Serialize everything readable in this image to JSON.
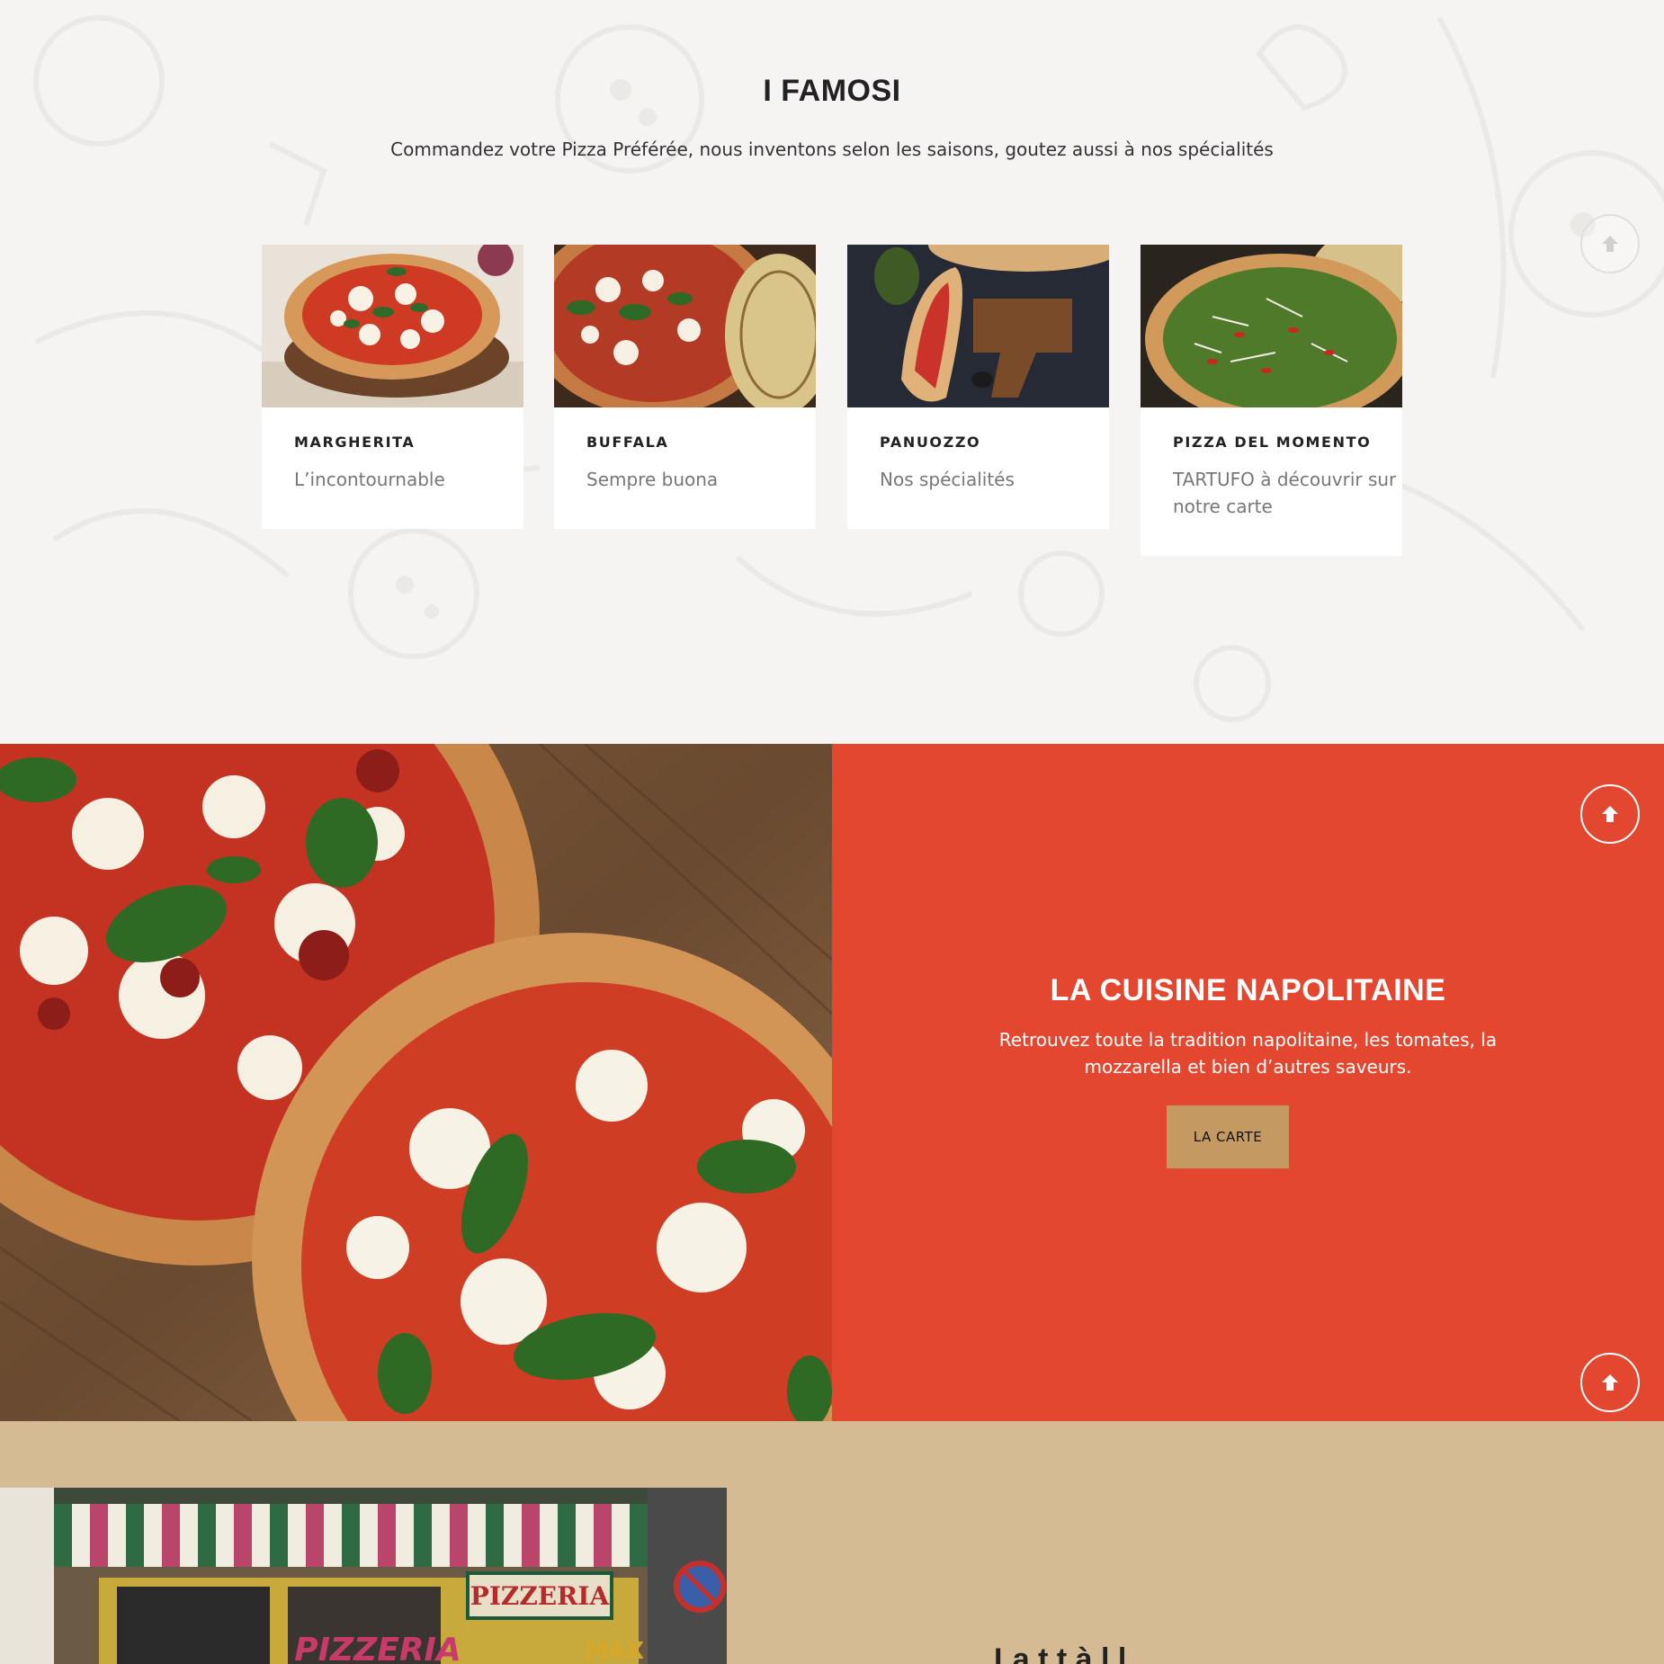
{
  "famosi": {
    "title": "I FAMOSI",
    "subtitle": "Commandez votre Pizza Préférée, nous inventons selon les saisons, goutez aussi à nos spécialités",
    "cards": [
      {
        "name": "MARGHERITA",
        "desc": "L’incontournable"
      },
      {
        "name": "BUFFALA",
        "desc": "Sempre buona"
      },
      {
        "name": "PANUOZZO",
        "desc": "Nos spécialités"
      },
      {
        "name": "PIZZA DEL MOMENTO",
        "desc": "TARTUFO à découvrir sur notre carte"
      }
    ]
  },
  "cuisine": {
    "title": "LA CUISINE NAPOLITAINE",
    "text": "Retrouvez toute la tradition napolitaine, les tomates, la mozzarella et bien d’autres saveurs.",
    "button_label": "LA CARTE"
  },
  "store": {
    "sign_text": "PIZZERIA",
    "sign_text_big": "PIZZERIA",
    "sign_text_small": "MAX"
  },
  "tan": {
    "heading_partial": "La t     t     à   l   l"
  },
  "icons": {
    "scroll_top": "arrow-up-icon"
  },
  "colors": {
    "background": "#f5f4f3",
    "accent_red": "#e4472f",
    "button_gold": "#c49a62",
    "tan": "#d4bb94"
  }
}
